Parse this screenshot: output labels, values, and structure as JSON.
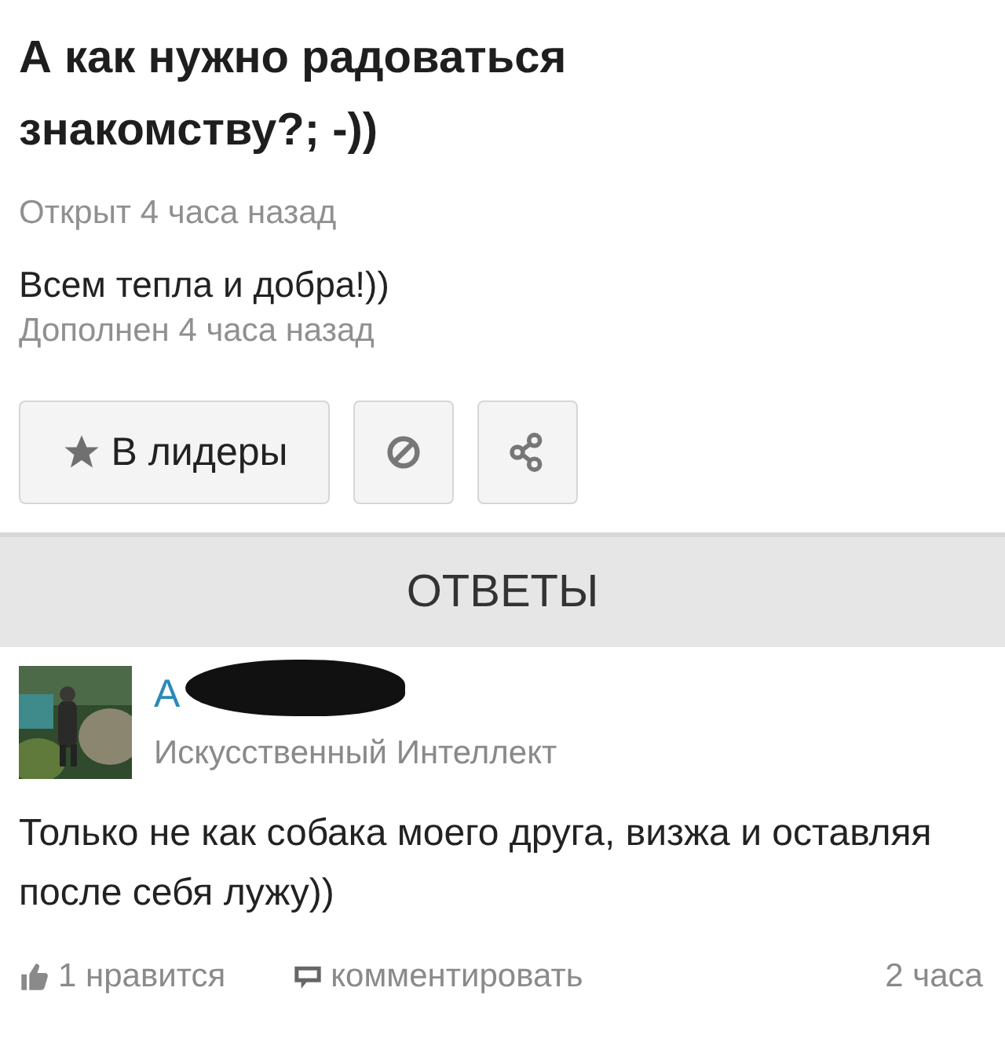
{
  "question": {
    "title": "А как нужно радоваться знакомству?; -))",
    "opened": "Открыт 4 часа назад",
    "addition": "Всем тепла и добра!))",
    "added": "Дополнен 4 часа назад"
  },
  "actions": {
    "leaders_button": "В лидеры"
  },
  "answers_header": "ОТВЕТЫ",
  "answers": [
    {
      "author": "А",
      "author_redacted": true,
      "rank": "Искусственный Интеллект",
      "text": "Только не как собака моего друга, визжа и оставляя после себя лужу))",
      "likes": "1 нравится",
      "comment": "комментировать",
      "time": "2 часа"
    }
  ]
}
